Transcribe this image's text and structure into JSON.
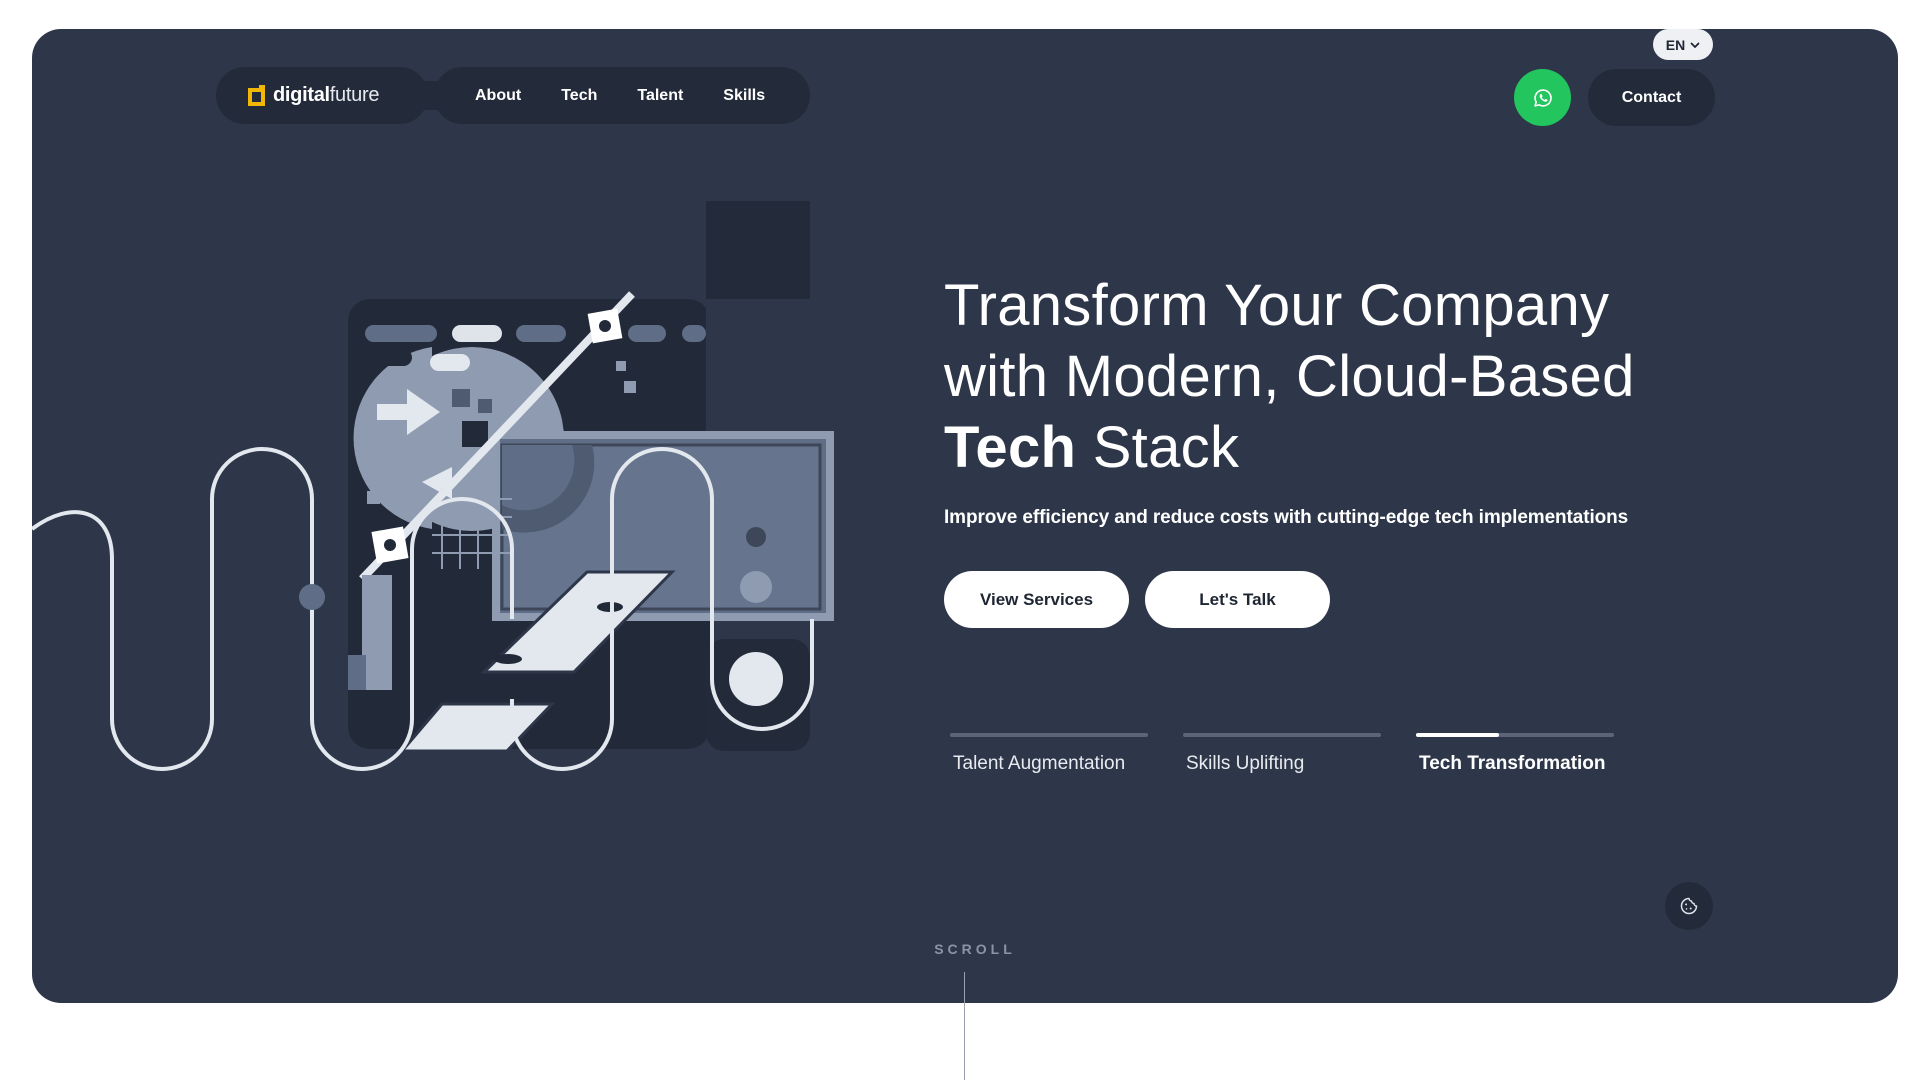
{
  "language": {
    "label": "EN",
    "icon": "chevron-down-icon"
  },
  "brand": {
    "name_bold": "digital",
    "name_light": "future",
    "accent": "#f2b705"
  },
  "nav": {
    "links": [
      "About",
      "Tech",
      "Talent",
      "Skills"
    ]
  },
  "actions": {
    "whatsapp_icon": "whatsapp-icon",
    "whatsapp_color": "#22c55e",
    "contact_label": "Contact"
  },
  "hero": {
    "headline_line1": "Transform Your Company",
    "headline_line2": "with Modern, Cloud-Based",
    "headline_strong": "Tech",
    "headline_rest": " Stack",
    "subline": "Improve efficiency and reduce costs with cutting-edge tech implementations",
    "primary_cta": "View Services",
    "secondary_cta": "Let's Talk",
    "background": "#2e3749"
  },
  "tabs": [
    {
      "label": "Talent Augmentation",
      "active": false,
      "progress": 0
    },
    {
      "label": "Skills Uplifting",
      "active": false,
      "progress": 0
    },
    {
      "label": "Tech Transformation",
      "active": true,
      "progress": 0.42
    }
  ],
  "cookie_icon": "cookie-icon",
  "scroll_label": "SCROLL"
}
